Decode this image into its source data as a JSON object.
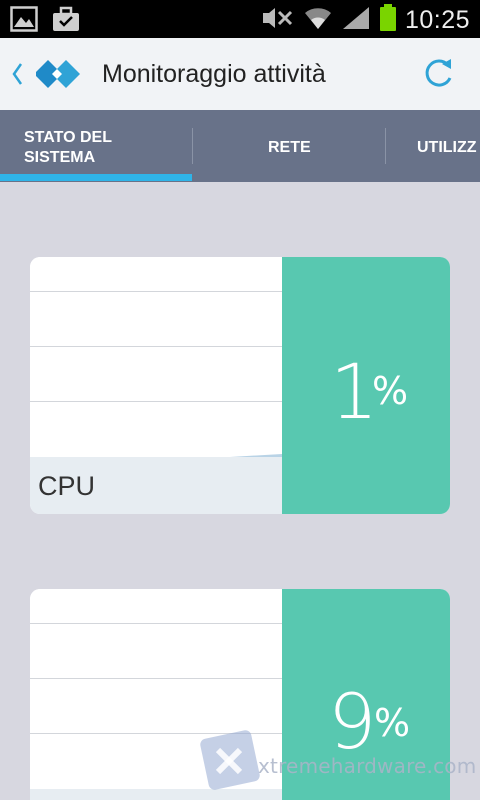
{
  "status_bar": {
    "time": "10:25",
    "left_icons": [
      "gallery-icon",
      "briefcase-icon"
    ],
    "right_icons": [
      "mute-icon",
      "wifi-icon",
      "signal-icon",
      "battery-icon"
    ],
    "battery_color": "#7ad400"
  },
  "action_bar": {
    "title": "Monitoraggio attività",
    "accent": "#2fa3d6"
  },
  "tabs": [
    {
      "label_line1": "STATO DEL",
      "label_line2": "SISTEMA",
      "selected": true
    },
    {
      "label_line1": "RETE",
      "label_line2": "",
      "selected": false
    },
    {
      "label_line1": "UTILIZZ",
      "label_line2": "",
      "selected": false
    }
  ],
  "cards": [
    {
      "label": "CPU",
      "value": "1",
      "unit": "%"
    },
    {
      "label": "",
      "value": "9",
      "unit": "%"
    }
  ],
  "colors": {
    "background": "#d7d7e0",
    "tabbar": "#687289",
    "tab_indicator": "#2fb4e8",
    "value_panel": "#58c8b0"
  },
  "watermark": {
    "text": "xtremehardware.com"
  }
}
